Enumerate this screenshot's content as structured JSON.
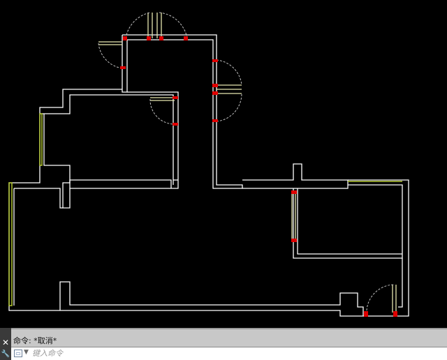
{
  "app": {
    "window_type": "cad-drawing-canvas",
    "background_color": "#000000"
  },
  "drawing": {
    "wall_color": "#ffffff",
    "window_color": "#b4c832",
    "door_color": "#e8e8b0",
    "door_swing_color": "#bfbfbf",
    "grip_marker_color": "#e00000"
  },
  "command_line": {
    "history_text": "命令: *取消*",
    "input_placeholder": "键入命令",
    "close_icon": "close-icon",
    "customize_icon": "wrench-icon",
    "prompt_icon": "command-prompt-icon",
    "dropdown_icon": "chevron-down-icon",
    "panel_color": "#c8c8c8"
  }
}
